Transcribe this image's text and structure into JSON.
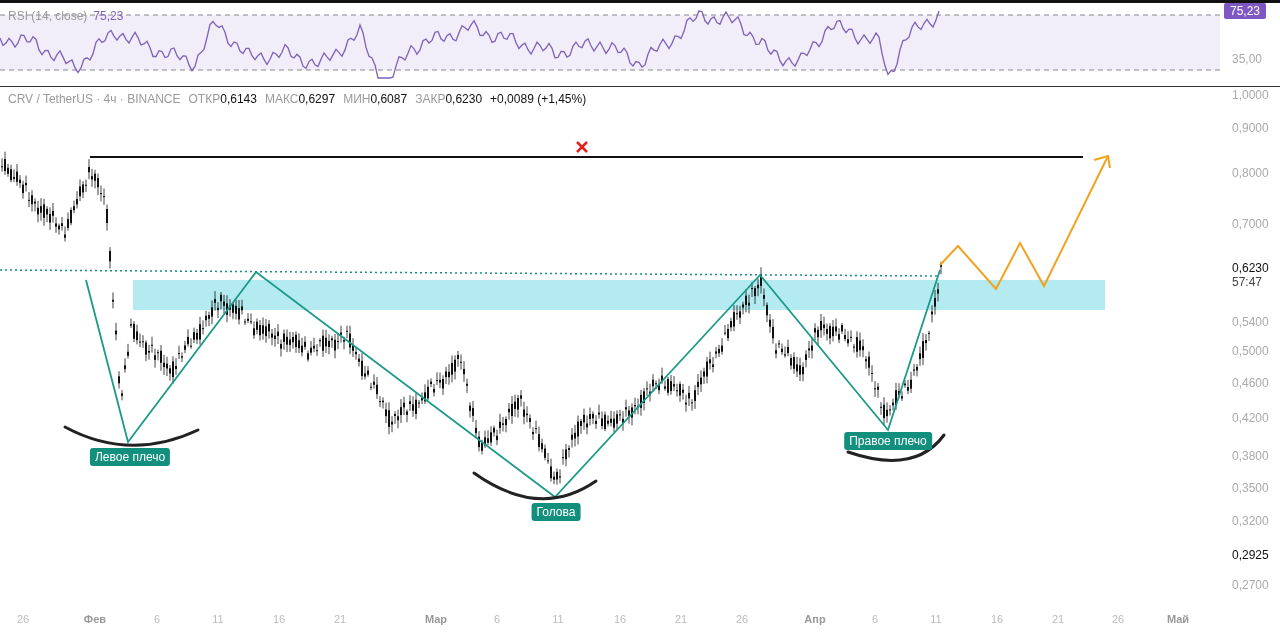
{
  "rsi_panel": {
    "label": "RSI (14, close)",
    "value": "75,23",
    "axis_badge": "75,23",
    "axis_labels": [
      "35,00"
    ]
  },
  "symbol_header": {
    "symbol": "CRV / TetherUS · 4ч · BINANCE",
    "fields": [
      {
        "label": "ОТКР",
        "value": "0,6143"
      },
      {
        "label": "МАКС",
        "value": "0,6297"
      },
      {
        "label": "МИН",
        "value": "0,6087"
      },
      {
        "label": "ЗАКР",
        "value": "0,6230"
      }
    ],
    "change": "+0,0089 (+1,45%)"
  },
  "price_axis": {
    "labels": [
      {
        "text": "1,0000",
        "kind": "tick"
      },
      {
        "text": "0,9000",
        "kind": "tick"
      },
      {
        "text": "0,8000",
        "kind": "tick"
      },
      {
        "text": "0,7000",
        "kind": "tick"
      },
      {
        "text": "0,6230",
        "kind": "current"
      },
      {
        "text": "57:47",
        "kind": "countdown"
      },
      {
        "text": "0,5400",
        "kind": "tick"
      },
      {
        "text": "0,5000",
        "kind": "tick"
      },
      {
        "text": "0,4600",
        "kind": "tick"
      },
      {
        "text": "0,4200",
        "kind": "tick"
      },
      {
        "text": "0,3800",
        "kind": "tick"
      },
      {
        "text": "0,3500",
        "kind": "tick"
      },
      {
        "text": "0,3200",
        "kind": "tick"
      },
      {
        "text": "0,2925",
        "kind": "marked"
      },
      {
        "text": "0,2700",
        "kind": "tick"
      }
    ]
  },
  "time_axis": {
    "labels": [
      {
        "text": "26",
        "kind": "day"
      },
      {
        "text": "Фев",
        "kind": "month"
      },
      {
        "text": "6",
        "kind": "day"
      },
      {
        "text": "11",
        "kind": "day"
      },
      {
        "text": "16",
        "kind": "day"
      },
      {
        "text": "21",
        "kind": "day"
      },
      {
        "text": "Мар",
        "kind": "month"
      },
      {
        "text": "6",
        "kind": "day"
      },
      {
        "text": "11",
        "kind": "day"
      },
      {
        "text": "16",
        "kind": "day"
      },
      {
        "text": "21",
        "kind": "day"
      },
      {
        "text": "26",
        "kind": "day"
      },
      {
        "text": "Апр",
        "kind": "month"
      },
      {
        "text": "6",
        "kind": "day"
      },
      {
        "text": "11",
        "kind": "day"
      },
      {
        "text": "16",
        "kind": "day"
      },
      {
        "text": "21",
        "kind": "day"
      },
      {
        "text": "26",
        "kind": "day"
      },
      {
        "text": "Май",
        "kind": "month"
      }
    ]
  },
  "annotations": [
    {
      "text": "Левое плечо"
    },
    {
      "text": "Голова"
    },
    {
      "text": "Правое плечо"
    }
  ]
}
